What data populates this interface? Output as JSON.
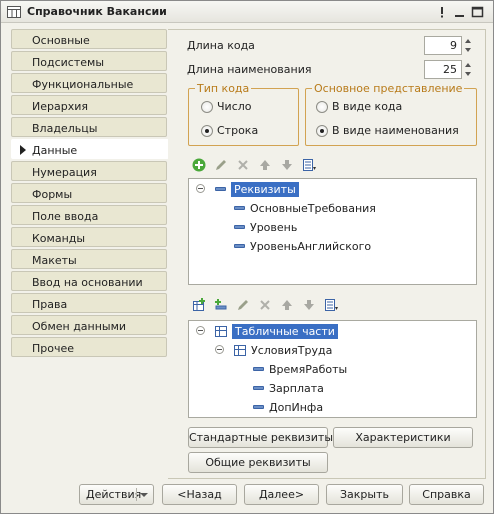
{
  "window": {
    "title": "Справочник Вакансии",
    "more_glyph": "!",
    "min_glyph": "–",
    "max_glyph": "□"
  },
  "nav": {
    "items": [
      {
        "label": "Основные"
      },
      {
        "label": "Подсистемы"
      },
      {
        "label": "Функциональные опции"
      },
      {
        "label": "Иерархия"
      },
      {
        "label": "Владельцы"
      },
      {
        "label": "Данные",
        "active": true
      },
      {
        "label": "Нумерация"
      },
      {
        "label": "Формы"
      },
      {
        "label": "Поле ввода"
      },
      {
        "label": "Команды"
      },
      {
        "label": "Макеты"
      },
      {
        "label": "Ввод на основании"
      },
      {
        "label": "Права"
      },
      {
        "label": "Обмен данными"
      },
      {
        "label": "Прочее"
      }
    ]
  },
  "data_tab": {
    "code_length_label": "Длина кода",
    "code_length_value": "9",
    "name_length_label": "Длина наименования",
    "name_length_value": "25",
    "code_type": {
      "legend": "Тип кода",
      "options": [
        "Число",
        "Строка"
      ],
      "selected": "Строка"
    },
    "main_presentation": {
      "legend": "Основное представление",
      "options": [
        "В виде кода",
        "В виде наименования"
      ],
      "selected": "В виде наименования"
    },
    "attributes_tree": {
      "root": "Реквизиты",
      "children": [
        "ОсновныеТребования",
        "Уровень",
        "УровеньАнглийского"
      ]
    },
    "tabular_tree": {
      "root": "Табличные части",
      "part": "УсловияТруда",
      "children": [
        "ВремяРаботы",
        "Зарплата",
        "ДопИнфа"
      ]
    },
    "buttons": {
      "standard": "Стандартные реквизиты",
      "characteristics": "Характеристики",
      "common": "Общие реквизиты"
    }
  },
  "footer": {
    "actions": "Действия",
    "back": "<Назад",
    "next": "Далее>",
    "close": "Закрыть",
    "help": "Справка"
  },
  "colors": {
    "accent_orange": "#d2a352",
    "selection_blue": "#3a6fc4",
    "nav_bg": "#e9e7d2"
  }
}
